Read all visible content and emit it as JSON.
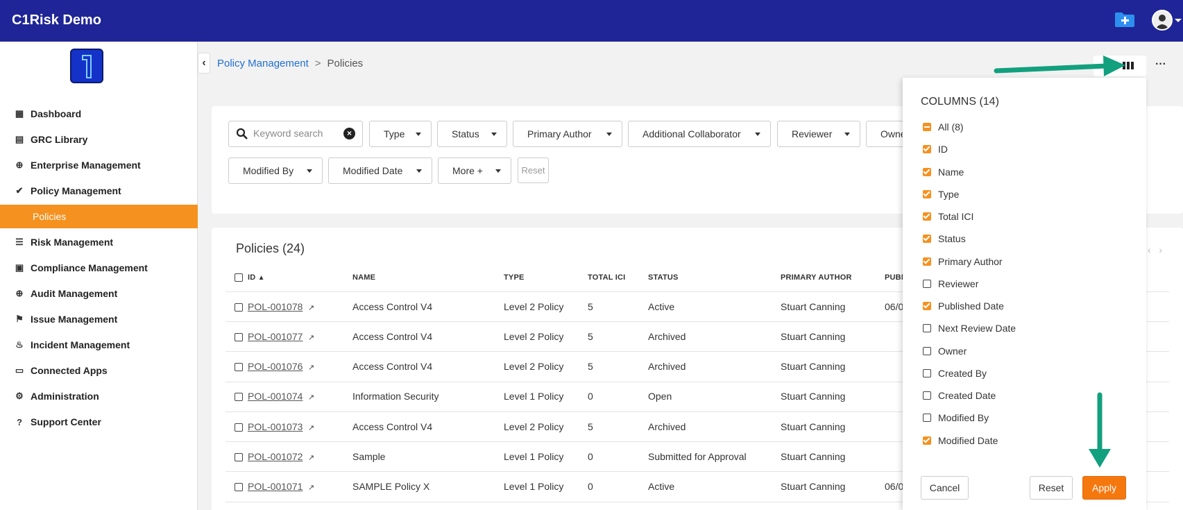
{
  "app": {
    "title": "C1Risk Demo"
  },
  "colors": {
    "topbar": "#1f2596",
    "accent": "#f5911f",
    "link": "#1f6fd1",
    "arrow": "#12a07e"
  },
  "sidebar": {
    "items": [
      {
        "label": "Dashboard",
        "icon": "grid-icon"
      },
      {
        "label": "GRC Library",
        "icon": "book-icon"
      },
      {
        "label": "Enterprise Management",
        "icon": "globe-icon"
      },
      {
        "label": "Policy Management",
        "icon": "check-icon"
      },
      {
        "label": "Policies",
        "icon": ""
      },
      {
        "label": "Risk Management",
        "icon": "list-icon"
      },
      {
        "label": "Compliance Management",
        "icon": "clipboard-icon"
      },
      {
        "label": "Audit Management",
        "icon": "crosshair-icon"
      },
      {
        "label": "Issue Management",
        "icon": "flag-icon"
      },
      {
        "label": "Incident Management",
        "icon": "fire-icon"
      },
      {
        "label": "Connected Apps",
        "icon": "store-icon"
      },
      {
        "label": "Administration",
        "icon": "gear-icon"
      },
      {
        "label": "Support Center",
        "icon": "help-icon"
      }
    ]
  },
  "breadcrumb": {
    "parent": "Policy Management",
    "separator": ">",
    "current": "Policies"
  },
  "filters": {
    "search_placeholder": "Keyword search",
    "buttons": [
      "Type",
      "Status",
      "Primary Author",
      "Additional Collaborator",
      "Reviewer",
      "Owne",
      "Modified By",
      "Modified Date",
      "More +"
    ],
    "reset": "Reset"
  },
  "table": {
    "title": "Policies (24)",
    "headers": [
      "ID",
      "NAME",
      "TYPE",
      "TOTAL ICI",
      "STATUS",
      "PRIMARY AUTHOR",
      "PUBLI"
    ],
    "rows": [
      [
        "POL-001078",
        "Access Control V4",
        "Level 2 Policy",
        "5",
        "Active",
        "Stuart Canning",
        "06/0"
      ],
      [
        "POL-001077",
        "Access Control V4",
        "Level 2 Policy",
        "5",
        "Archived",
        "Stuart Canning",
        ""
      ],
      [
        "POL-001076",
        "Access Control V4",
        "Level 2 Policy",
        "5",
        "Archived",
        "Stuart Canning",
        ""
      ],
      [
        "POL-001074",
        "Information Security",
        "Level 1 Policy",
        "0",
        "Open",
        "Stuart Canning",
        ""
      ],
      [
        "POL-001073",
        "Access Control V4",
        "Level 2 Policy",
        "5",
        "Archived",
        "Stuart Canning",
        ""
      ],
      [
        "POL-001072",
        "Sample",
        "Level 1 Policy",
        "0",
        "Submitted for Approval",
        "Stuart Canning",
        ""
      ],
      [
        "POL-001071",
        "SAMPLE Policy X",
        "Level 1 Policy",
        "0",
        "Active",
        "Stuart Canning",
        "06/0"
      ]
    ]
  },
  "columns_panel": {
    "title": "COLUMNS (14)",
    "options": [
      {
        "label": "All (8)",
        "state": "partial"
      },
      {
        "label": "ID",
        "state": "on"
      },
      {
        "label": "Name",
        "state": "on"
      },
      {
        "label": "Type",
        "state": "on"
      },
      {
        "label": "Total ICI",
        "state": "on"
      },
      {
        "label": "Status",
        "state": "on"
      },
      {
        "label": "Primary Author",
        "state": "on"
      },
      {
        "label": "Reviewer",
        "state": "off"
      },
      {
        "label": "Published Date",
        "state": "on"
      },
      {
        "label": "Next Review Date",
        "state": "off"
      },
      {
        "label": "Owner",
        "state": "off"
      },
      {
        "label": "Created By",
        "state": "off"
      },
      {
        "label": "Created Date",
        "state": "off"
      },
      {
        "label": "Modified By",
        "state": "off"
      },
      {
        "label": "Modified Date",
        "state": "on"
      }
    ],
    "cancel": "Cancel",
    "reset": "Reset",
    "apply": "Apply"
  }
}
